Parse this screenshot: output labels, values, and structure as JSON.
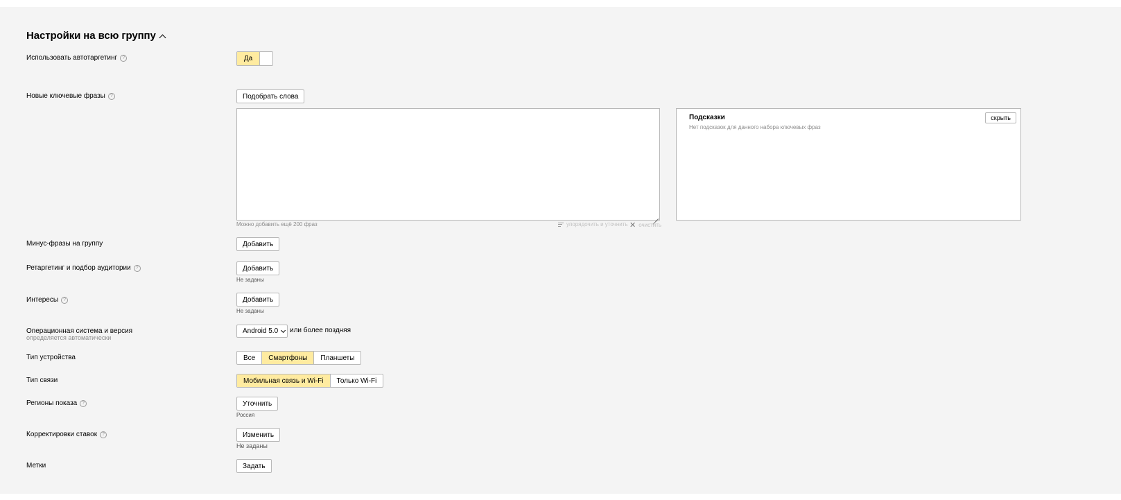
{
  "section": {
    "title": "Настройки на всю группу"
  },
  "autotargeting": {
    "label": "Использовать автотаргетинг",
    "toggle_on": "Да"
  },
  "keywords": {
    "label": "Новые ключевые фразы",
    "pick_button": "Подобрать слова",
    "limit_hint": "Можно добавить ещё 200 фраз",
    "sort_action": "упорядочить и уточнить",
    "clear_action": "очистить"
  },
  "hints": {
    "title": "Подсказки",
    "hide_button": "скрыть",
    "empty_text": "Нет подсказок для данного набора ключевых фраз"
  },
  "minus_phrases": {
    "label": "Минус-фразы на группу",
    "button": "Добавить"
  },
  "retargeting": {
    "label": "Ретаргетинг и подбор аудитории",
    "button": "Добавить",
    "status": "Не заданы"
  },
  "interests": {
    "label": "Интересы",
    "button": "Добавить",
    "status": "Не заданы"
  },
  "os": {
    "label": "Операционная система и версия",
    "sublabel": "определяется автоматически",
    "selected": "Android 5.0",
    "suffix": "или более поздняя"
  },
  "device_type": {
    "label": "Тип устройства",
    "options": [
      "Все",
      "Смартфоны",
      "Планшеты"
    ],
    "active": "Смартфоны"
  },
  "connection_type": {
    "label": "Тип связи",
    "options": [
      "Мобильная связь и Wi-Fi",
      "Только Wi-Fi"
    ],
    "active": "Мобильная связь и Wi-Fi"
  },
  "regions": {
    "label": "Регионы показа",
    "button": "Уточнить",
    "value": "Россия"
  },
  "bid_adjustments": {
    "label": "Корректировки ставок",
    "button": "Изменить",
    "status": "Не заданы"
  },
  "tags": {
    "label": "Метки",
    "button": "Задать"
  },
  "colors": {
    "active_bg": "#ffeba0",
    "panel_bg": "#f4f4f4",
    "border": "#b8b8b8"
  }
}
